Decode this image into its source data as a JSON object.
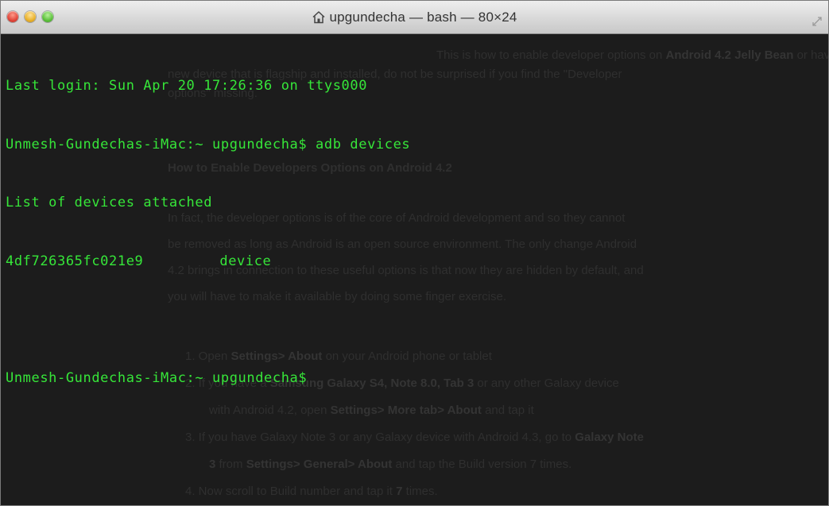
{
  "window": {
    "title": "upgundecha — bash — 80×24",
    "title_icon": "home-icon",
    "accent_text_color": "#36e639",
    "background_color": "#1c1c1c"
  },
  "terminal": {
    "lines": {
      "last_login": "Last login: Sun Apr 20 17:26:36 on ttys000",
      "command_line": "Unmesh-Gundechas-iMac:~ upgundecha$ adb devices",
      "devices_header": "List of devices attached",
      "device_id": "4df726365fc021e9",
      "device_state": "device",
      "blank": "",
      "prompt": "Unmesh-Gundechas-iMac:~ upgundecha$"
    }
  },
  "background_article": {
    "line1_pre": "This is how to enable developer options on ",
    "line1_bold": "Android 4.2 Jelly Bean",
    "line1_post": " or have bought a",
    "line2": "new device that is flagship and installed, do not be surprised if you find the \"Developer",
    "line3": "options\" missing.",
    "heading": "How to Enable Developers Options on Android 4.2",
    "para1": "In fact, the developer options is of the core of Android development and so they cannot",
    "para2": "be removed as long as Android is an open source environment. The only change Android",
    "para3": "4.2 brings in connection to these useful options is that now they are hidden by default, and",
    "para4": "you will have to make it available by doing some finger exercise.",
    "step1_pre": "1.  Open ",
    "step1_bold": "Settings> About",
    "step1_post": " on your Android phone or tablet",
    "step2_pre": "2.  If you have a ",
    "step2_bold": "Samsung Galaxy S4, Note 8.0, Tab 3",
    "step2_post": " or any other Galaxy device",
    "step2b_pre": "with Android 4.2, open ",
    "step2b_bold": "Settings> More tab> About",
    "step2b_post": " and tap it",
    "step3_pre": "3.  If you have Galaxy Note 3 or any Galaxy device with Android 4.3, go to ",
    "step3_bold": "Galaxy Note",
    "step3b_bold": "3",
    "step3b_mid": " from ",
    "step3b_bold2": "Settings> General> About",
    "step3b_post": " and tap the Build version 7 times.",
    "step4_pre": "4.  Now scroll to Build number and tap it ",
    "step4_bold": "7",
    "step4_post": " times."
  }
}
